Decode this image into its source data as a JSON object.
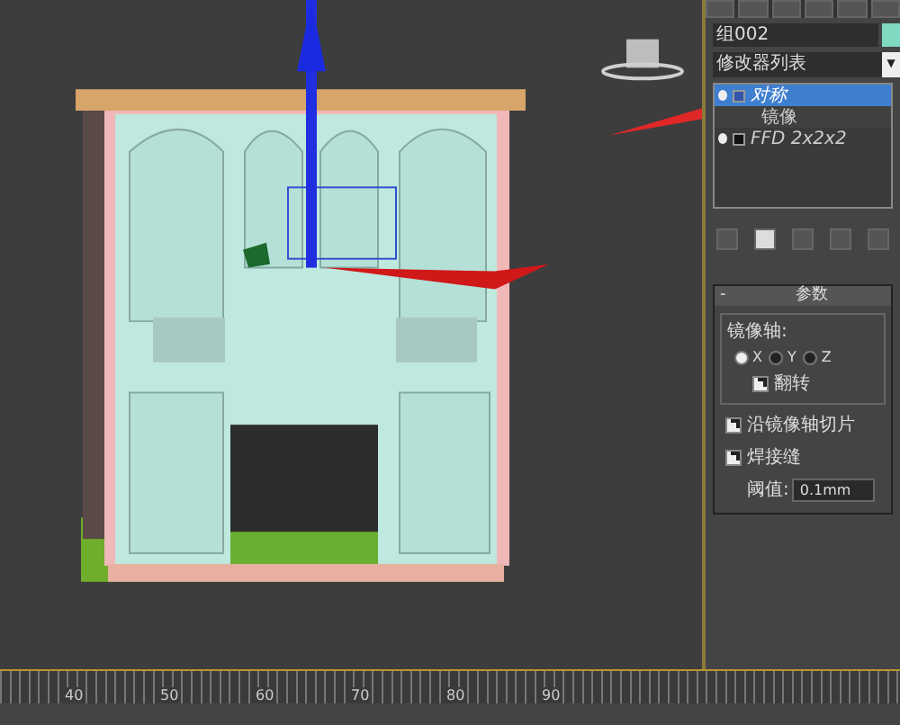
{
  "command_panel": {
    "object_name": "组002",
    "modifier_list": {
      "placeholder": "修改器列表",
      "caret": "▼"
    },
    "modifier_stack": [
      {
        "label": "对称",
        "selected": true,
        "on": true,
        "expanded": true,
        "children": [
          {
            "label": "镜像",
            "selected": false
          }
        ]
      },
      {
        "label": "FFD 2x2x2",
        "selected": false,
        "on": true,
        "expanded": false
      }
    ]
  },
  "parameters": {
    "rollout": "参数",
    "collapse": "-",
    "group_title": "镜像轴:",
    "axes": [
      {
        "label": "X",
        "selected": true
      },
      {
        "label": "Y",
        "selected": false
      },
      {
        "label": "Z",
        "selected": false
      }
    ],
    "options": [
      {
        "kind": "sub",
        "label": "翻转",
        "checked": true
      },
      {
        "kind": "main",
        "label": "沿镜像轴切片",
        "checked": true
      },
      {
        "kind": "main",
        "label": "焊接缝",
        "checked": true
      }
    ],
    "threshold": {
      "label": "阈值:",
      "value": "0.1mm"
    }
  },
  "timeline": {
    "ticks": [
      "40",
      "50",
      "60",
      "70",
      "80",
      "90"
    ]
  }
}
